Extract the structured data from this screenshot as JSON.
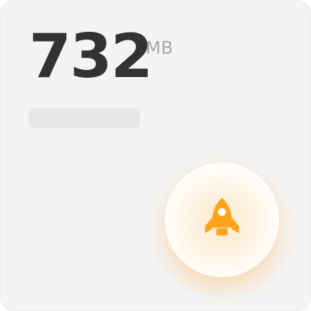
{
  "memory": {
    "value": "732",
    "unit": "MB"
  },
  "boost": {
    "icon": "rocket-icon",
    "accent_color": "#FFA31A"
  },
  "colors": {
    "card_background": "#F4F4F4",
    "value_text": "#333333",
    "unit_text": "#A8A8A8",
    "placeholder_bar": "#E6E6E6"
  }
}
